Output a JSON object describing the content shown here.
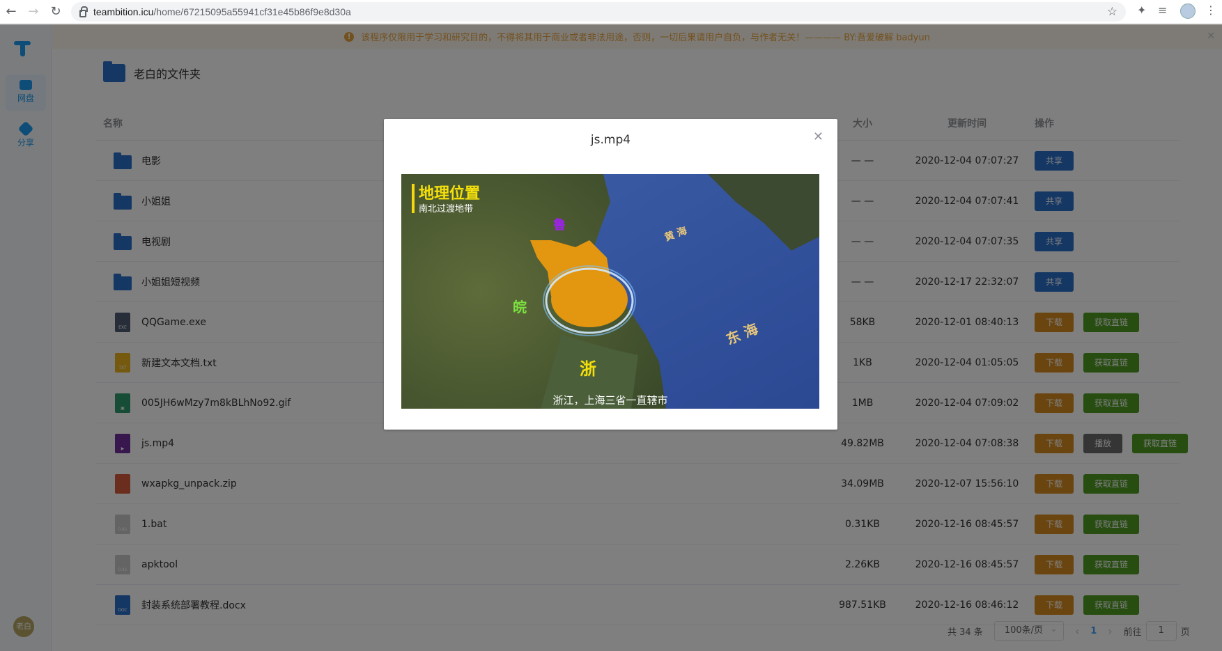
{
  "browser": {
    "url_host": "teambition.icu",
    "url_path": "/home/67215095a55941cf31e45b86f9e8d30a"
  },
  "sidebar": {
    "items": [
      {
        "label": "网盘"
      },
      {
        "label": "分享"
      }
    ],
    "avatar_text": "老白"
  },
  "notice": {
    "text": "该程序仅限用于学习和研究目的，不得将其用于商业或者非法用途，否则，一切后果请用户自负，与作者无关！————  BY:吾爱破解 badyun"
  },
  "folder": {
    "title": "老白的文件夹"
  },
  "table": {
    "headers": {
      "name": "名称",
      "size": "大小",
      "time": "更新时间",
      "ops": "操作"
    },
    "rows": [
      {
        "name": "电影",
        "type": "folder",
        "size": "— —",
        "time": "2020-12-04 07:07:27",
        "ops": [
          "共享"
        ]
      },
      {
        "name": "小姐姐",
        "type": "folder",
        "size": "— —",
        "time": "2020-12-04 07:07:41",
        "ops": [
          "共享"
        ]
      },
      {
        "name": "电视剧",
        "type": "folder",
        "size": "— —",
        "time": "2020-12-04 07:07:35",
        "ops": [
          "共享"
        ]
      },
      {
        "name": "小姐姐短视频",
        "type": "folder",
        "size": "— —",
        "time": "2020-12-17 22:32:07",
        "ops": [
          "共享"
        ]
      },
      {
        "name": "QQGame.exe",
        "type": "exe",
        "size": "58KB",
        "time": "2020-12-01 08:40:13",
        "ops": [
          "下载",
          "获取直链"
        ]
      },
      {
        "name": "新建文本文档.txt",
        "type": "txt",
        "size": "1KB",
        "time": "2020-12-04 01:05:05",
        "ops": [
          "下载",
          "获取直链"
        ]
      },
      {
        "name": "005JH6wMzy7m8kBLhNo92.gif",
        "type": "gif",
        "size": "1MB",
        "time": "2020-12-04 07:09:02",
        "ops": [
          "下载",
          "获取直链"
        ]
      },
      {
        "name": "js.mp4",
        "type": "mp4",
        "size": "49.82MB",
        "time": "2020-12-04 07:08:38",
        "ops": [
          "下载",
          "播放",
          "获取直链"
        ]
      },
      {
        "name": "wxapkg_unpack.zip",
        "type": "zip",
        "size": "34.09MB",
        "time": "2020-12-07 15:56:10",
        "ops": [
          "下载",
          "获取直链"
        ]
      },
      {
        "name": "1.bat",
        "type": "bat",
        "size": "0.31KB",
        "time": "2020-12-16 08:45:57",
        "ops": [
          "下载",
          "获取直链"
        ]
      },
      {
        "name": "apktool",
        "type": "bat",
        "size": "2.26KB",
        "time": "2020-12-16 08:45:57",
        "ops": [
          "下载",
          "获取直链"
        ]
      },
      {
        "name": "封装系统部署教程.docx",
        "type": "docx",
        "size": "987.51KB",
        "time": "2020-12-16 08:46:12",
        "ops": [
          "下载",
          "获取直链"
        ]
      }
    ]
  },
  "pager": {
    "total": "共 34 条",
    "page_size": "100条/页",
    "current": "1",
    "goto_prefix": "前往",
    "goto_value": "1",
    "goto_suffix": "页"
  },
  "dialog": {
    "title": "js.mp4",
    "video": {
      "heading": "地理位置",
      "subheading": "南北过渡地带",
      "label_lu": "鲁",
      "label_wan": "皖",
      "label_zhe": "浙",
      "label_huanghai": "黄 海",
      "label_donghai": "东 海",
      "caption": "浙江，上海三省一直辖市"
    }
  },
  "colors": {
    "share": "#2b6fc9",
    "download": "#d68a1e",
    "link": "#4e9a23",
    "play": "#6b6b6b"
  }
}
